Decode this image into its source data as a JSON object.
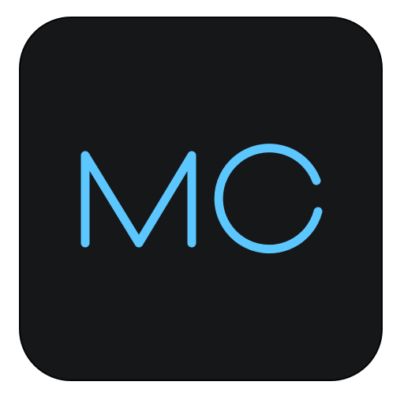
{
  "app_icon": {
    "monogram": "MC",
    "background_color": "#161719",
    "border_color": "#050505",
    "letter_color": "#5cc6ff",
    "shape": "rounded-square"
  }
}
